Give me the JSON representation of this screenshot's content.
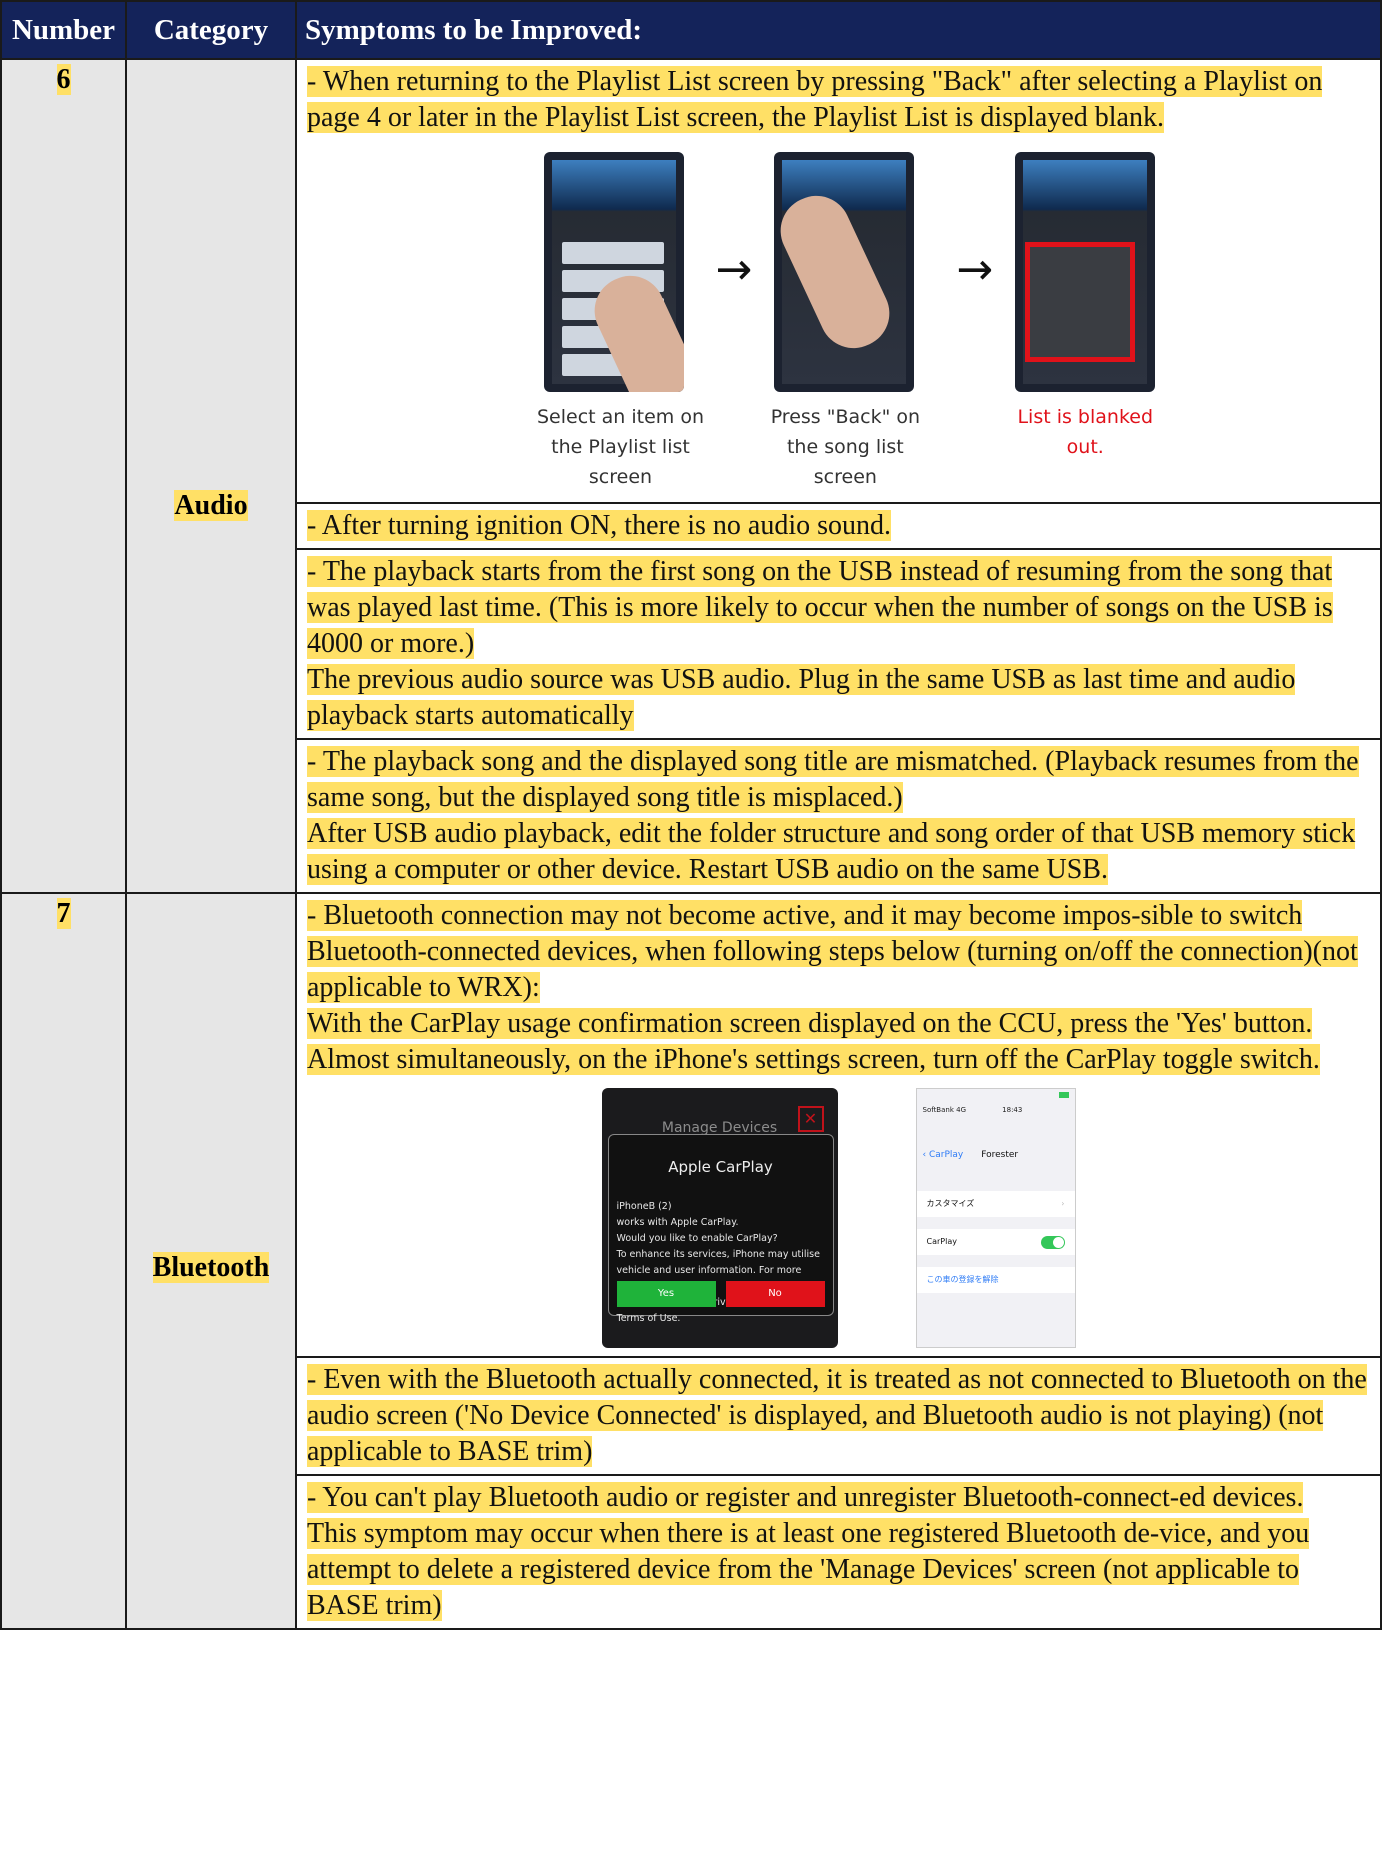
{
  "header": {
    "number": "Number",
    "category": "Category",
    "symptoms": "Symptoms to be Improved:"
  },
  "rows": [
    {
      "number": "6",
      "category": "Audio",
      "items": [
        {
          "lines": [
            "- When returning to the Playlist List screen by pressing \"Back\" after selecting a Playlist on page 4 or later in the Playlist List screen, the Playlist List is displayed blank."
          ]
        },
        {
          "lines": [
            "- After turning ignition ON, there is no audio sound."
          ]
        },
        {
          "lines": [
            "- The playback starts from the first song on the USB instead of resuming from the song that was played last time. (This is more likely to occur when the number of songs on the USB is 4000 or more.)",
            "The previous audio source was USB audio. Plug in the same USB as last time and audio playback starts automatically"
          ]
        },
        {
          "lines": [
            "- The playback song and the displayed song title are mismatched. (Playback resumes from the same song, but the displayed song title is misplaced.)",
            "After USB audio playback, edit the folder structure and song order of that USB memory stick using a computer or other device. Restart USB audio on the same USB."
          ]
        }
      ],
      "figure": {
        "captions": [
          "Select an item on the Playlist list screen",
          "Press \"Back\" on the song list screen",
          "List is blanked out."
        ],
        "arrow": "→"
      }
    },
    {
      "number": "7",
      "category": "Bluetooth",
      "items": [
        {
          "lines": [
            "- Bluetooth connection may not become active, and it may become impos-sible to switch Bluetooth-connected devices, when following steps below (turning on/off the connection)(not applicable to WRX):",
            "With the CarPlay usage confirmation screen displayed on the CCU, press the 'Yes' button. Almost simultaneously, on the iPhone's settings screen, turn off the CarPlay toggle switch."
          ]
        },
        {
          "lines": [
            "- Even with the Bluetooth actually connected, it is treated as not connected to Bluetooth on the audio screen ('No Device Connected' is displayed, and Bluetooth audio is not playing) (not applicable to BASE trim)"
          ]
        },
        {
          "lines": [
            "- You can't play Bluetooth audio or register and unregister Bluetooth-connect-ed devices.",
            "This symptom may occur when there is at least one registered Bluetooth de-vice, and you attempt to delete a registered device from the 'Manage Devices' screen (not applicable to BASE trim)"
          ]
        }
      ],
      "figure": {
        "ccu": {
          "title": "Manage Devices",
          "close": "✕",
          "card_title": "Apple CarPlay",
          "body": [
            "iPhoneB (2)",
            "works with Apple CarPlay.",
            "Would you like to enable CarPlay?",
            "To enhance its services, iPhone may utilise",
            "vehicle and user information. For more details,",
            "please see Apple's Privacy Policy and iOS Terms of Use."
          ],
          "yes": "Yes",
          "no": "No",
          "yes_color": "#1fb33a",
          "no_color": "#e0121a"
        },
        "iphone": {
          "carrier": "SoftBank 4G",
          "time": "18:43",
          "back": "CarPlay",
          "title": "Forester",
          "row1": "カスタマイズ",
          "row2": "CarPlay",
          "row3": "この車の登録を解除"
        }
      }
    }
  ],
  "colors": {
    "header_bg": "#14235a",
    "highlight": "#ffe066",
    "shade": "#e6e6e6"
  }
}
